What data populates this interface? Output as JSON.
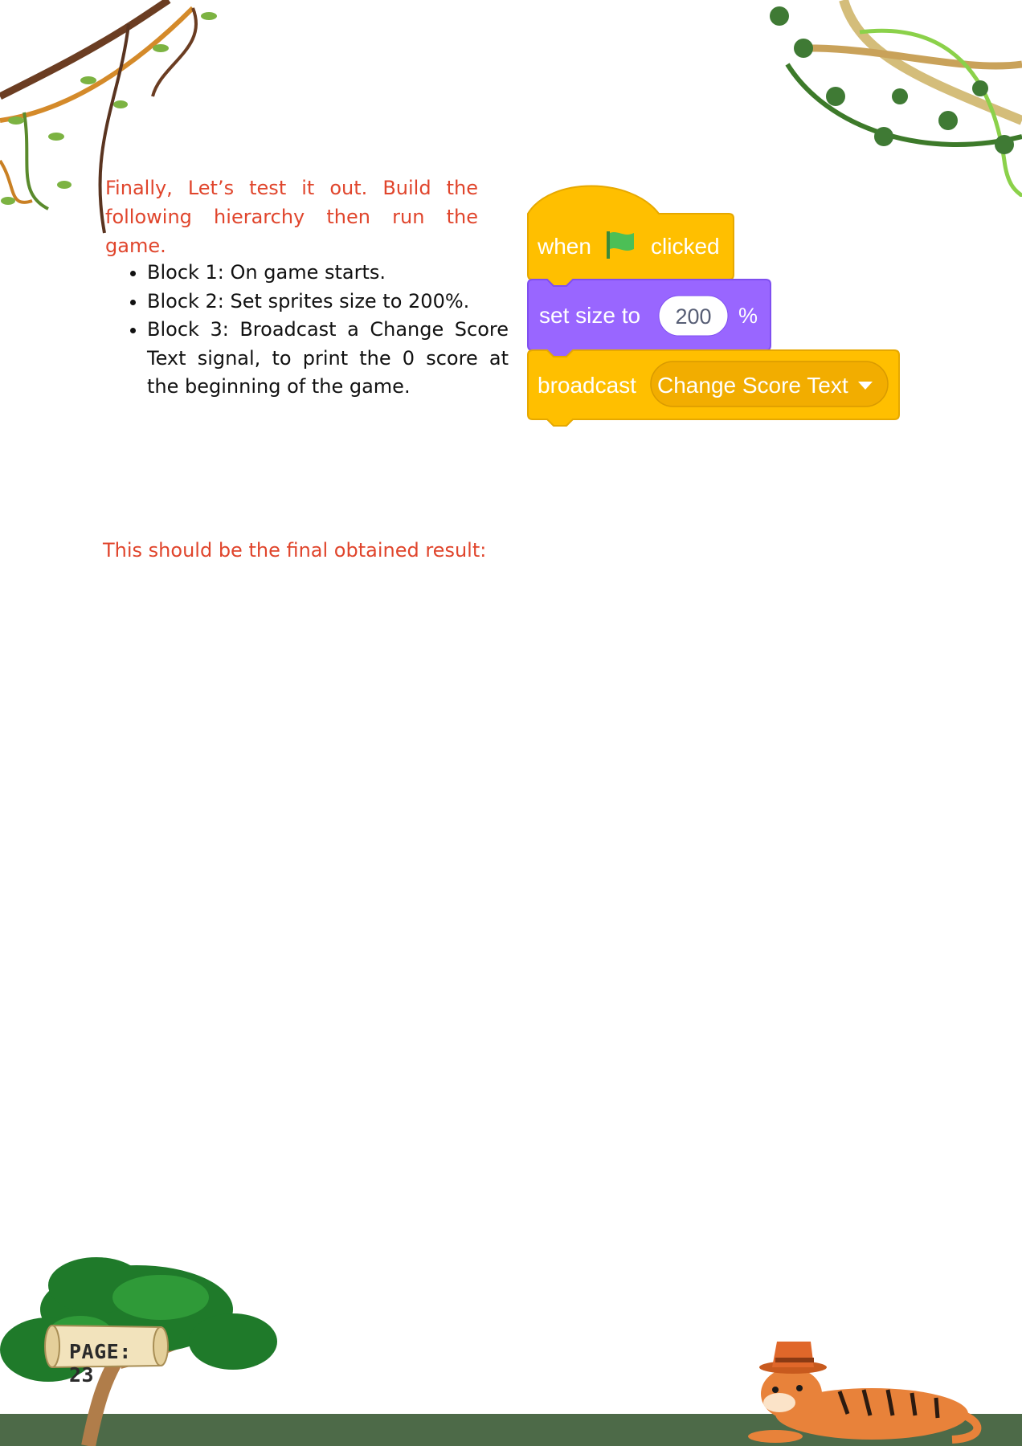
{
  "intro": "Finally, Let’s test it out. Build the following hierarchy then run the game.",
  "bullets": [
    "Block 1: On game starts.",
    "Block 2: Set sprites size to 200%.",
    "Block 3: Broadcast a Change Score Text signal, to print the 0 score at the beginning of the game."
  ],
  "result_heading": "This should be the final obtained result:",
  "page_label": "PAGE: 23",
  "scratch": {
    "event_block": {
      "text_before": "when",
      "icon": "green-flag-icon",
      "text_after": "clicked"
    },
    "size_block": {
      "label": "set size to",
      "value": "200",
      "unit": "%"
    },
    "broadcast_block": {
      "label": "broadcast",
      "message": "Change Score Text",
      "dropdown_icon": "dropdown-arrow-icon"
    }
  },
  "colors": {
    "accent_text": "#e0452c",
    "events_block": "#ffbf00",
    "looks_block": "#9966ff",
    "ground": "#4d6a48"
  },
  "decorations": [
    "jungle-vines",
    "tree",
    "tiger-with-hat",
    "scroll-page-label"
  ]
}
